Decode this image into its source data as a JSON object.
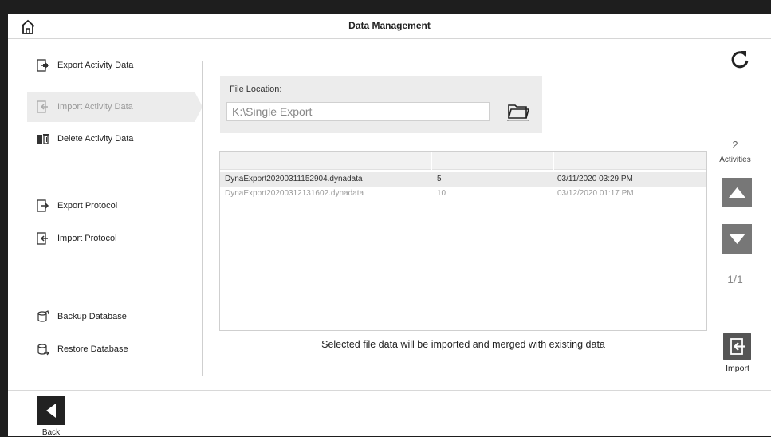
{
  "header": {
    "title": "Data Management",
    "home_icon": "home-icon"
  },
  "sidebar": {
    "items": [
      {
        "label": "Export Activity Data",
        "icon": "export-icon",
        "active": false
      },
      {
        "label": "Import Activity Data",
        "icon": "import-icon",
        "active": true
      },
      {
        "label": "Delete Activity Data",
        "icon": "trash-icon",
        "active": false
      },
      {
        "label": "Export Protocol",
        "icon": "export-icon",
        "active": false
      },
      {
        "label": "Import Protocol",
        "icon": "import-icon",
        "active": false
      },
      {
        "label": "Backup Database",
        "icon": "backup-icon",
        "active": false
      },
      {
        "label": "Restore Database",
        "icon": "restore-icon",
        "active": false
      }
    ]
  },
  "file_location": {
    "label": "File Location:",
    "value": "K:\\Single Export",
    "browse_icon": "folder-icon"
  },
  "table": {
    "rows": [
      {
        "file": "DynaExport20200311152904.dynadata",
        "count": "5",
        "date": "03/11/2020 03:29 PM",
        "selected": true
      },
      {
        "file": "DynaExport20200312131602.dynadata",
        "count": "10",
        "date": "03/12/2020 01:17 PM",
        "selected": false
      }
    ]
  },
  "hint": "Selected file data will be imported and merged with existing data",
  "right_panel": {
    "refresh_icon": "refresh-icon",
    "count": "2",
    "count_label": "Activities",
    "page": "1/1",
    "import_label": "Import"
  },
  "footer": {
    "back_label": "Back"
  },
  "colors": {
    "accent_gray": "#777777",
    "active_bg": "#ececec",
    "window_bg": "#ffffff"
  }
}
